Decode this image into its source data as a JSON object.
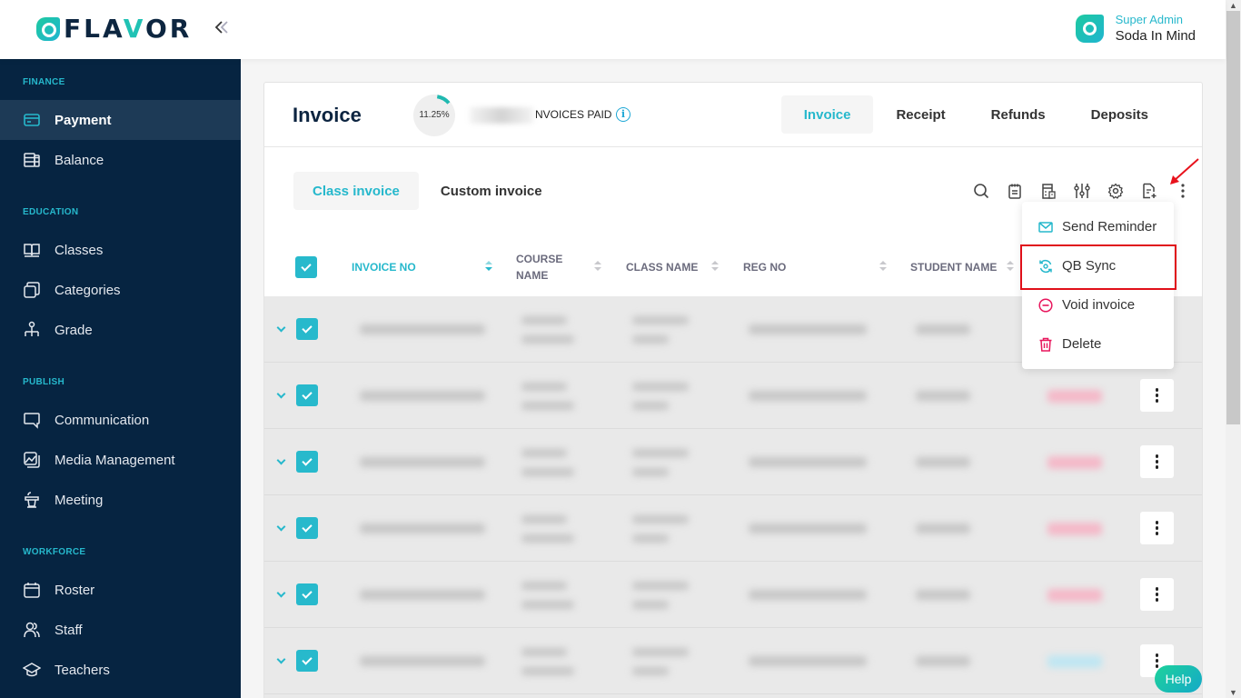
{
  "header": {
    "logo_text_pre": "FLA",
    "logo_text_v": "V",
    "logo_text_post": "OR",
    "collapse_icon": "double-chevron-left-icon",
    "user": {
      "role": "Super Admin",
      "name": "Soda In Mind"
    }
  },
  "sidebar": {
    "sections": [
      {
        "title": "FINANCE",
        "items": [
          {
            "label": "Payment",
            "icon": "credit-card-icon",
            "active": true
          },
          {
            "label": "Balance",
            "icon": "database-icon"
          }
        ]
      },
      {
        "title": "EDUCATION",
        "items": [
          {
            "label": "Classes",
            "icon": "book-icon"
          },
          {
            "label": "Categories",
            "icon": "layers-icon"
          },
          {
            "label": "Grade",
            "icon": "hierarchy-icon"
          }
        ]
      },
      {
        "title": "PUBLISH",
        "items": [
          {
            "label": "Communication",
            "icon": "chat-icon"
          },
          {
            "label": "Media Management",
            "icon": "image-icon"
          },
          {
            "label": "Meeting",
            "icon": "podium-icon"
          }
        ]
      },
      {
        "title": "WORKFORCE",
        "items": [
          {
            "label": "Roster",
            "icon": "calendar-icon"
          },
          {
            "label": "Staff",
            "icon": "users-icon"
          },
          {
            "label": "Teachers",
            "icon": "graduation-cap-icon"
          }
        ]
      }
    ]
  },
  "page": {
    "title": "Invoice",
    "progress": {
      "value_label": "11.25%",
      "fraction": 0.1125
    },
    "paid_label": "NVOICES PAID",
    "top_tabs": [
      {
        "label": "Invoice",
        "active": true
      },
      {
        "label": "Receipt"
      },
      {
        "label": "Refunds"
      },
      {
        "label": "Deposits"
      }
    ],
    "sub_tabs": [
      {
        "label": "Class invoice",
        "active": true
      },
      {
        "label": "Custom invoice"
      }
    ],
    "toolbar": [
      "search-icon",
      "clipboard-icon",
      "calculator-icon",
      "filter-sliders-icon",
      "settings-icon",
      "file-add-icon",
      "more-vertical-icon"
    ]
  },
  "table": {
    "columns": [
      "INVOICE NO",
      "COURSE NAME",
      "CLASS NAME",
      "REG NO",
      "STUDENT NAME"
    ],
    "column_lines": [
      [
        "INVOICE NO"
      ],
      [
        "COURSE",
        "NAME"
      ],
      [
        "CLASS NAME"
      ],
      [
        "REG NO"
      ],
      [
        "STUDENT NAME"
      ]
    ],
    "rows": [
      {
        "status": "none",
        "checked": true
      },
      {
        "status": "pink",
        "checked": true
      },
      {
        "status": "pink",
        "checked": true
      },
      {
        "status": "pink",
        "checked": true
      },
      {
        "status": "pink",
        "checked": true
      },
      {
        "status": "blue",
        "checked": true
      }
    ]
  },
  "dropdown": {
    "items": [
      {
        "label": "Send Reminder",
        "icon": "mail-icon",
        "color": "#26b8cc"
      },
      {
        "label": "QB Sync",
        "icon": "sync-icon",
        "color": "#26b8cc",
        "highlighted": true
      },
      {
        "label": "Void invoice",
        "icon": "minus-circle-icon",
        "color": "#e8175d"
      },
      {
        "label": "Delete",
        "icon": "trash-icon",
        "color": "#e8175d"
      }
    ]
  },
  "help_label": "Help",
  "colors": {
    "accent": "#26b8cc",
    "sidebar_bg": "#062441",
    "danger": "#e8175d",
    "highlight": "#e0101a"
  }
}
